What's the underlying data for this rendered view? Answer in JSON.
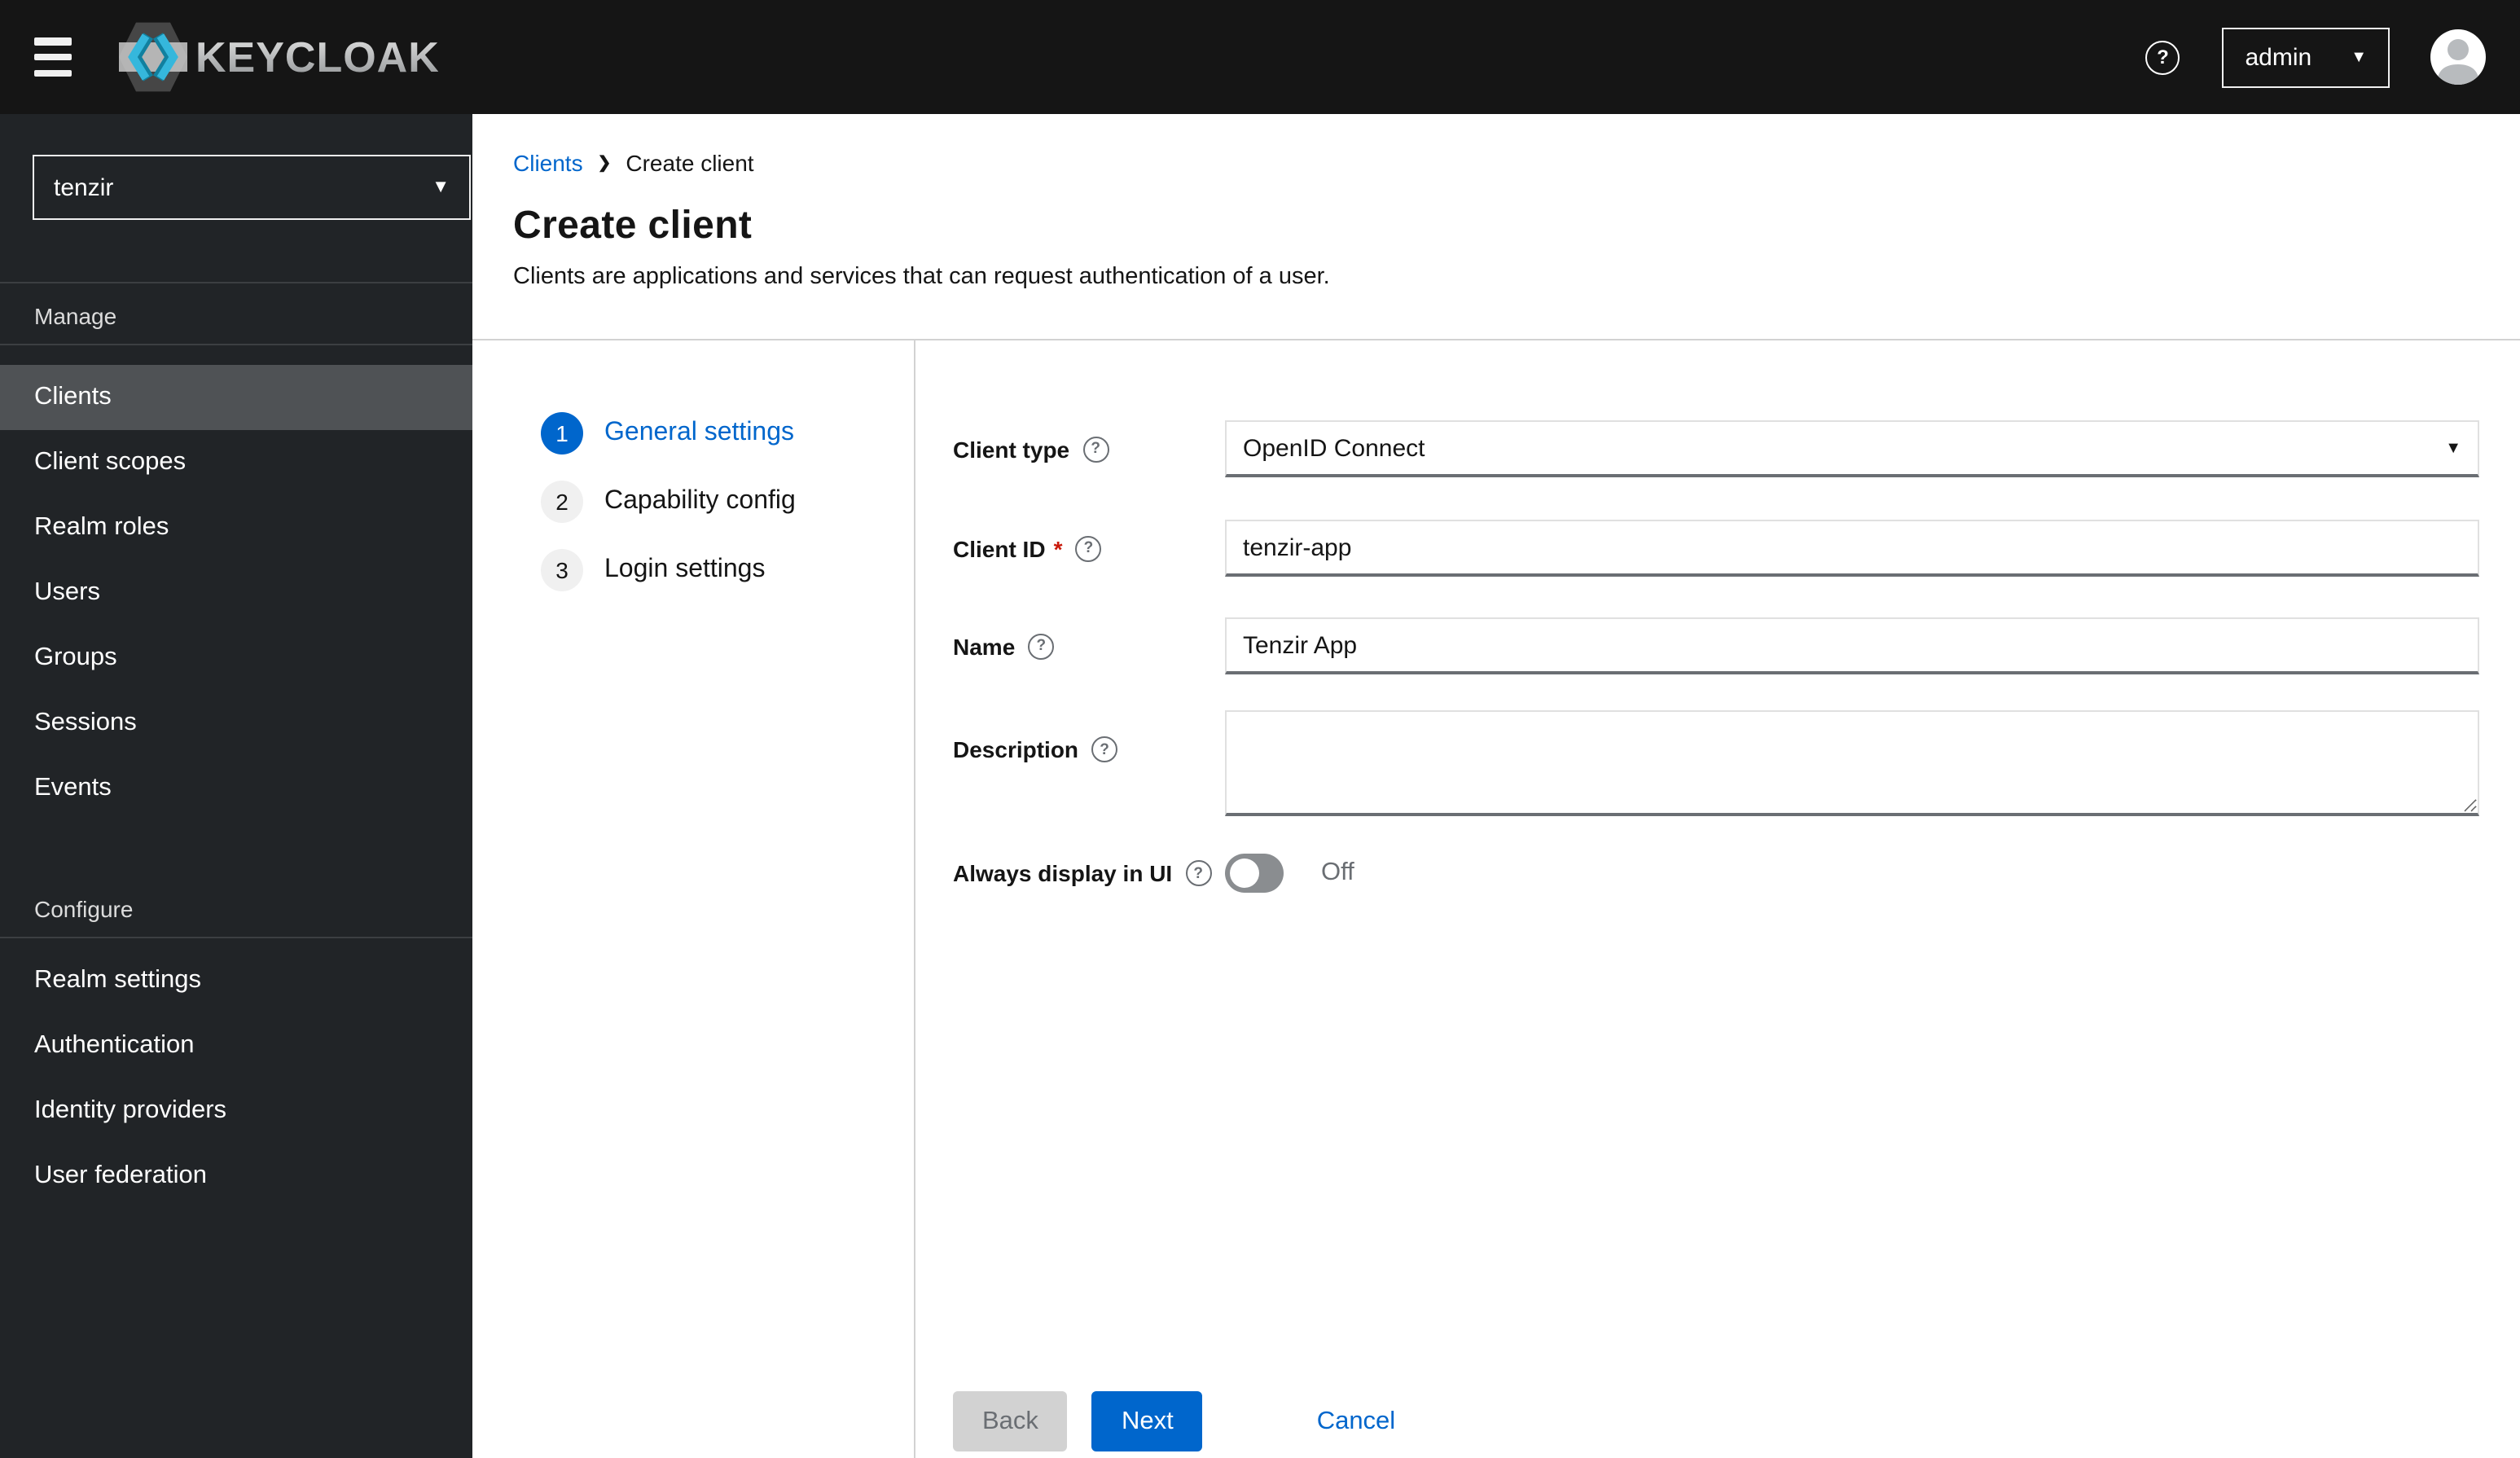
{
  "masthead": {
    "brand": "KEYCLOAK",
    "username": "admin"
  },
  "sidebar": {
    "realm_selector": {
      "value": "tenzir"
    },
    "sections": [
      {
        "title": "Manage",
        "items": [
          {
            "label": "Clients",
            "active": true
          },
          {
            "label": "Client scopes",
            "active": false
          },
          {
            "label": "Realm roles",
            "active": false
          },
          {
            "label": "Users",
            "active": false
          },
          {
            "label": "Groups",
            "active": false
          },
          {
            "label": "Sessions",
            "active": false
          },
          {
            "label": "Events",
            "active": false
          }
        ]
      },
      {
        "title": "Configure",
        "items": [
          {
            "label": "Realm settings",
            "active": false
          },
          {
            "label": "Authentication",
            "active": false
          },
          {
            "label": "Identity providers",
            "active": false
          },
          {
            "label": "User federation",
            "active": false
          }
        ]
      }
    ]
  },
  "breadcrumb": {
    "items": [
      {
        "label": "Clients"
      },
      {
        "label": "Create client"
      }
    ]
  },
  "page": {
    "title": "Create client",
    "subtitle": "Clients are applications and services that can request authentication of a user."
  },
  "wizard": {
    "steps": [
      {
        "number": "1",
        "label": "General settings",
        "active": true
      },
      {
        "number": "2",
        "label": "Capability config",
        "active": false
      },
      {
        "number": "3",
        "label": "Login settings",
        "active": false
      }
    ]
  },
  "form": {
    "client_type": {
      "label": "Client type",
      "value": "OpenID Connect"
    },
    "client_id": {
      "label": "Client ID",
      "required_marker": "*",
      "value": "tenzir-app"
    },
    "name": {
      "label": "Name",
      "value": "Tenzir App"
    },
    "description": {
      "label": "Description",
      "value": ""
    },
    "always_display": {
      "label": "Always display in UI",
      "state": "Off"
    }
  },
  "actions": {
    "back": "Back",
    "next": "Next",
    "cancel": "Cancel"
  },
  "icons": {
    "hamburger": "menu-icon",
    "help": "question-circle-icon",
    "caret_down": "caret-down-icon",
    "avatar": "user-avatar-icon",
    "breadcrumb_separator": "chevron-right-icon",
    "field_help": "question-circle-icon"
  },
  "colors": {
    "accent": "#0066cc",
    "masthead_bg": "#151515",
    "sidebar_bg": "#212427",
    "nav_selected_bg": "#4f5255",
    "divider": "#d2d2d2",
    "sidebar_divider": "#3c3f42",
    "disabled_bg": "#d2d2d2",
    "disabled_text": "#6a6e73",
    "required_red": "#c9190b",
    "toggle_off": "#8a8d90",
    "logo_cyan": "#35b7dc"
  }
}
